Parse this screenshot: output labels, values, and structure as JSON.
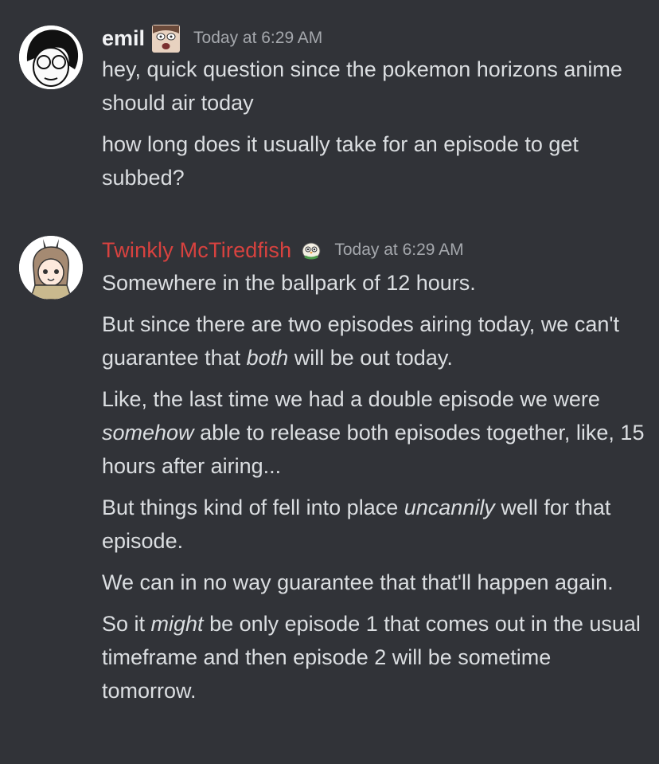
{
  "messages": [
    {
      "username": "emil",
      "timestamp": "Today at 6:29 AM",
      "role_icon": "face-emoji-icon",
      "lines": [
        "hey, quick question since the pokemon horizons anime should air today",
        "how long does it usually take for an episode to get subbed?"
      ]
    },
    {
      "username": "Twinkly McTiredfish",
      "timestamp": "Today at 6:29 AM",
      "role_icon": "rowlet-icon",
      "lines": [
        {
          "pre": "Somewhere in the ballpark of 12 hours.",
          "em": "",
          "post": ""
        },
        {
          "pre": "But since there are two episodes airing today, we can't guarantee that ",
          "em": "both",
          "post": " will be out today."
        },
        {
          "pre": "Like, the last time we had a double episode we were ",
          "em": "somehow",
          "post": " able to release both episodes together, like, 15 hours after airing..."
        },
        {
          "pre": "But things kind of fell into place ",
          "em": "uncannily",
          "post": " well for that episode."
        },
        {
          "pre": "We can in no way guarantee that that'll happen again.",
          "em": "",
          "post": ""
        },
        {
          "pre": "So it ",
          "em": "might",
          "post": " be only episode 1 that comes out in the usual timeframe and then episode 2 will be sometime tomorrow."
        }
      ]
    }
  ],
  "colors": {
    "background": "#313338",
    "text": "#dbdee1",
    "timestamp": "#a5a8ad",
    "twinkly_name": "#d8423f"
  }
}
